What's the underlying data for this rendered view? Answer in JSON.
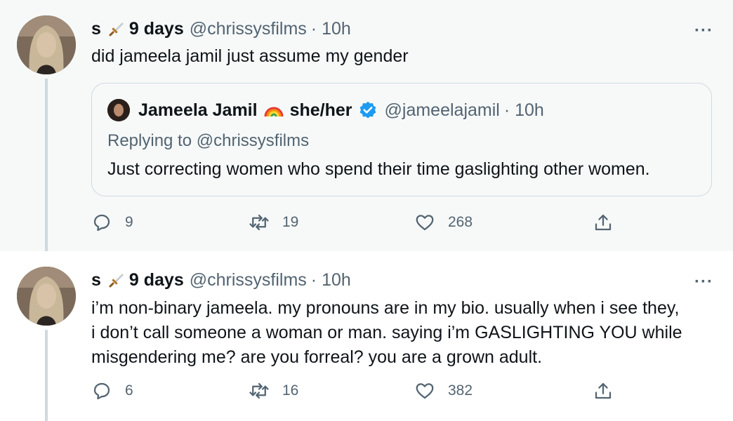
{
  "tweets": [
    {
      "display_name": "s",
      "name_suffix": "9 days",
      "handle": "@chrissysfilms",
      "time": "· 10h",
      "more": "···",
      "text_lines": [
        "did jameela jamil just assume my gender"
      ],
      "quote": {
        "display_name": "Jameela Jamil",
        "pronouns": "she/her",
        "handle": "@jameelajamil",
        "time": "· 10h",
        "replying_prefix": "Replying to",
        "replying_handle": "@chrissysfilms",
        "text": "Just correcting women who spend their time gaslighting other women."
      },
      "reply_count": "9",
      "retweet_count": "19",
      "like_count": "268"
    },
    {
      "display_name": "s",
      "name_suffix": "9 days",
      "handle": "@chrissysfilms",
      "time": "· 10h",
      "more": "···",
      "text_lines": [
        "i’m non-binary jameela. my pronouns are in my bio. usually when i see they,",
        "i don’t call someone a woman or man. saying i’m GASLIGHTING YOU while",
        "misgendering me? are you forreal? you are a grown adult."
      ],
      "reply_count": "6",
      "retweet_count": "16",
      "like_count": "382"
    }
  ],
  "icons": {
    "dagger": "dagger-icon",
    "rainbow": "rainbow-icon",
    "verified": "verified-badge-icon",
    "reply": "reply-icon",
    "retweet": "retweet-icon",
    "like": "like-icon",
    "share": "share-icon"
  },
  "colors": {
    "text": "#0f1419",
    "secondary": "#536471",
    "verified": "#1d9bf0",
    "highlight_bg": "#f7f9f9",
    "border": "#cfd9de"
  }
}
